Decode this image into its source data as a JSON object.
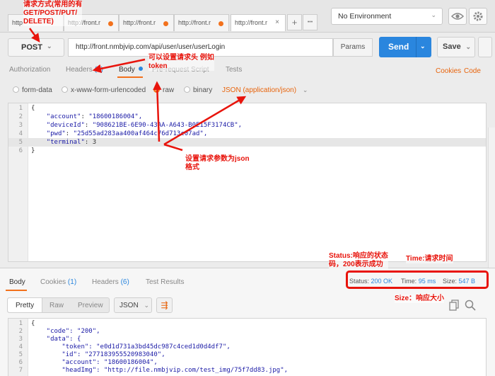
{
  "tabs": [
    {
      "label": "http",
      "dirty": false
    },
    {
      "label": "http://front.r",
      "dirty": true
    },
    {
      "label": "http://front.r",
      "dirty": true
    },
    {
      "label": "http://front.r",
      "dirty": true
    },
    {
      "label": "http://front.r",
      "dirty": false,
      "active": true
    }
  ],
  "tab_close": "×",
  "add_tab": "+",
  "more_tabs": "•••",
  "environment": {
    "selected": "No Environment",
    "chevron": "⌄"
  },
  "request": {
    "method": "POST",
    "method_chevron": "⌄",
    "url": "http://front.nmbjvip.com/api/user/user/userLogin",
    "params_label": "Params",
    "send_label": "Send",
    "send_chevron": "⌄",
    "save_label": "Save",
    "save_chevron": "⌄"
  },
  "request_tabs": [
    {
      "label": "Authorization"
    },
    {
      "label": "Headers",
      "count": "(1)"
    },
    {
      "label": "Body",
      "active": true
    },
    {
      "label": "Pre-request Script"
    },
    {
      "label": "Tests"
    }
  ],
  "links": {
    "cookies": "Cookies",
    "code": "Code"
  },
  "body_types": [
    {
      "label": "form-data",
      "selected": false
    },
    {
      "label": "x-www-form-urlencoded",
      "selected": false
    },
    {
      "label": "raw",
      "selected": true
    },
    {
      "label": "binary",
      "selected": false
    }
  ],
  "raw_format": "JSON (application/json)",
  "raw_format_chevron": "⌄",
  "request_body": [
    {
      "n": "1",
      "text": "{"
    },
    {
      "n": "2",
      "key": "\"account\"",
      "value": "\"18600186004\","
    },
    {
      "n": "3",
      "key": "\"deviceId\"",
      "value": "\"908621BE-6E90-43AA-A643-B0E15F3174CB\","
    },
    {
      "n": "4",
      "key": "\"pwd\"",
      "value": "\"25d55ad283aa400af464c76d713c07ad\","
    },
    {
      "n": "5",
      "key": "\"terminal\"",
      "value": "3"
    },
    {
      "n": "6",
      "text": "}"
    }
  ],
  "response": {
    "tabs": [
      {
        "label": "Body",
        "active": true
      },
      {
        "label": "Cookies",
        "count": "(1)"
      },
      {
        "label": "Headers",
        "count": "(6)"
      },
      {
        "label": "Test Results"
      }
    ],
    "status_label": "Status:",
    "status_value": "200 OK",
    "time_label": "Time:",
    "time_value": "95 ms",
    "size_label": "Size:",
    "size_value": "547 B",
    "view_modes": [
      "Pretty",
      "Raw",
      "Preview"
    ],
    "format": "JSON",
    "format_chevron": "⌄",
    "wrap_glyph": "⇶",
    "body": [
      {
        "n": "1",
        "text": "{"
      },
      {
        "n": "2",
        "text": "    \"code\": \"200\","
      },
      {
        "n": "3",
        "text": "    \"data\": {"
      },
      {
        "n": "4",
        "text": "        \"token\": \"e0d1d731a3bd45dc987c4ced1d0d4df7\","
      },
      {
        "n": "5",
        "text": "        \"id\": \"277183955520983040\","
      },
      {
        "n": "6",
        "text": "        \"account\": \"18600186004\","
      },
      {
        "n": "7",
        "text": "        \"headImg\": \"http://file.nmbjvip.com/test_img/75f7dd83.jpg\","
      }
    ]
  },
  "annotations": {
    "method_note": [
      "请求方式(常用的有",
      "GET/POST/PUT/",
      "DELETE)"
    ],
    "header_note": [
      "可以设置请求头 例如",
      "token"
    ],
    "json_note": [
      "设置请求参数为json",
      "格式"
    ],
    "status_note": [
      "Status:响应的状态",
      "码，200表示成功"
    ],
    "time_note": "Time:请求时间",
    "size_note": "Size：响应大小"
  },
  "colors": {
    "accent": "#f2711c",
    "send": "#2a86de",
    "annotation": "#e8140c",
    "link": "#e8640c"
  }
}
